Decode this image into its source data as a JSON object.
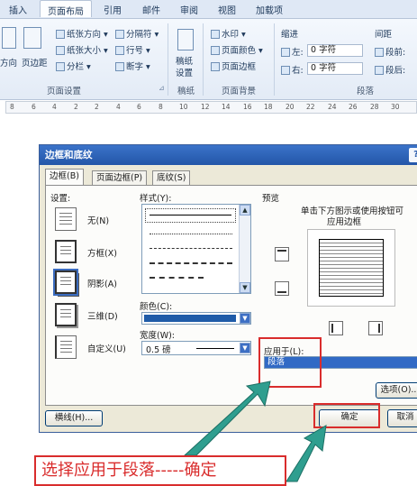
{
  "ribbon": {
    "tabs": [
      "插入",
      "页面布局",
      "引用",
      "邮件",
      "审阅",
      "视图",
      "加载项"
    ],
    "active_tab": "页面布局",
    "page_setup": {
      "orientation_label": "方向",
      "margins_label": "页边距",
      "paper_direction": "纸张方向 ▾",
      "paper_size": "纸张大小 ▾",
      "columns": "分栏 ▾",
      "breaks": "分隔符 ▾",
      "line_numbers": "行号 ▾",
      "hyphenation": "断字 ▾",
      "group_label": "页面设置"
    },
    "manuscript": {
      "label1": "稿纸",
      "label2": "设置",
      "group_label": "稿纸"
    },
    "page_background": {
      "watermark": "水印 ▾",
      "page_color": "页面颜色 ▾",
      "page_borders": "页面边框",
      "group_label": "页面背景"
    },
    "indent": {
      "title": "缩进",
      "left_label": "左:",
      "left_value": "0 字符",
      "right_label": "右:",
      "right_value": "0 字符"
    },
    "spacing": {
      "title": "间距",
      "before_label": "段前:",
      "after_label": "段后:"
    },
    "paragraph_group_label": "段落"
  },
  "ruler": {
    "numbers": [
      "8",
      "6",
      "4",
      "2",
      "2",
      "4",
      "6",
      "8",
      "10",
      "12",
      "14",
      "16",
      "18",
      "20",
      "22",
      "24",
      "26",
      "28",
      "30"
    ]
  },
  "dialog": {
    "title": "边框和底纹",
    "help_glyph": "?",
    "tabs": [
      "边框(B)",
      "页面边框(P)",
      "底纹(S)"
    ],
    "settings_label": "设置:",
    "settings": [
      "无(N)",
      "方框(X)",
      "阴影(A)",
      "三维(D)",
      "自定义(U)"
    ],
    "style_label": "样式(Y):",
    "color_label": "颜色(C):",
    "color_value": "#1f5ba8",
    "width_label": "宽度(W):",
    "width_value": "0.5 磅",
    "preview_label": "预览",
    "preview_hint_1": "单击下方图示或使用按钮可",
    "preview_hint_2": "应用边框",
    "apply_to_label": "应用于(L):",
    "apply_to_value": "段落",
    "options_button": "选项(O)...",
    "horizontal_line_button": "横线(H)...",
    "ok_button": "确定",
    "cancel_button": "取消"
  },
  "annotation": {
    "caption": "选择应用于段落-----确定",
    "accent_color": "#d92c2c",
    "arrow_color": "#2f9e8f"
  }
}
